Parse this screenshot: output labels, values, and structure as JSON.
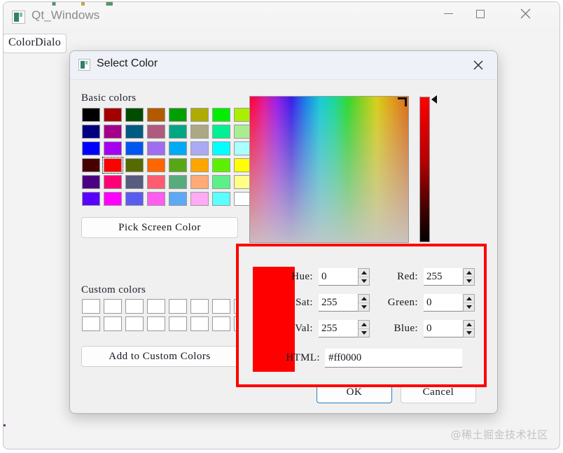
{
  "app": {
    "title": "Qt_Windows",
    "icon": "qt-app-icon",
    "tab_label": "ColorDialo",
    "window_controls": {
      "minimize": "minimize-icon",
      "maximize": "maximize-icon",
      "close": "close-icon"
    },
    "watermark": "@稀土掘金技术社区"
  },
  "dialog": {
    "title": "Select Color",
    "icon": "qt-dialog-icon",
    "close_icon": "close-icon",
    "basic_colors_label": "Basic colors",
    "custom_colors_label": "Custom colors",
    "pick_screen_color_label": "Pick Screen Color",
    "add_to_custom_colors_label": "Add to Custom Colors",
    "ok_label": "OK",
    "cancel_label": "Cancel",
    "basic_colors": [
      "#000000",
      "#a50000",
      "#004d00",
      "#b35a00",
      "#00a000",
      "#b0ab00",
      "#00ee00",
      "#aaee00",
      "#000080",
      "#a5008c",
      "#005b82",
      "#b05a7e",
      "#00a782",
      "#aca884",
      "#00f093",
      "#aaed90",
      "#0000ff",
      "#a500f0",
      "#0057f0",
      "#a06cf0",
      "#00aaf5",
      "#aaaaf5",
      "#00ffff",
      "#aaffff",
      "#470000",
      "#ff0000",
      "#556b00",
      "#ff6600",
      "#57a616",
      "#ffa500",
      "#5bf000",
      "#ffff00",
      "#4b0082",
      "#ff0077",
      "#575c80",
      "#ff5c72",
      "#57ab7d",
      "#ffaa77",
      "#5cf088",
      "#ffff88",
      "#5a00ff",
      "#ff00ff",
      "#5a5cf0",
      "#ff5cf0",
      "#5caaf5",
      "#ffaaf5",
      "#5cffff",
      "#ffffff"
    ],
    "selected_swatch_index": 25,
    "custom_colors": [
      "#ffffff",
      "#ffffff",
      "#ffffff",
      "#ffffff",
      "#ffffff",
      "#ffffff",
      "#ffffff",
      "#ffffff",
      "#ffffff",
      "#ffffff",
      "#ffffff",
      "#ffffff",
      "#ffffff",
      "#ffffff",
      "#ffffff",
      "#ffffff"
    ],
    "preview_color": "#ff0000",
    "fields": {
      "hue_label": "Hue:",
      "hue_value": "0",
      "sat_label": "Sat:",
      "sat_value": "255",
      "val_label": "Val:",
      "val_value": "255",
      "red_label": "Red:",
      "red_value": "255",
      "green_label": "Green:",
      "green_value": "0",
      "blue_label": "Blue:",
      "blue_value": "0",
      "html_label": "HTML:",
      "html_value": "#ff0000"
    },
    "annotation": {
      "highlight_color": "#ff0000"
    }
  }
}
